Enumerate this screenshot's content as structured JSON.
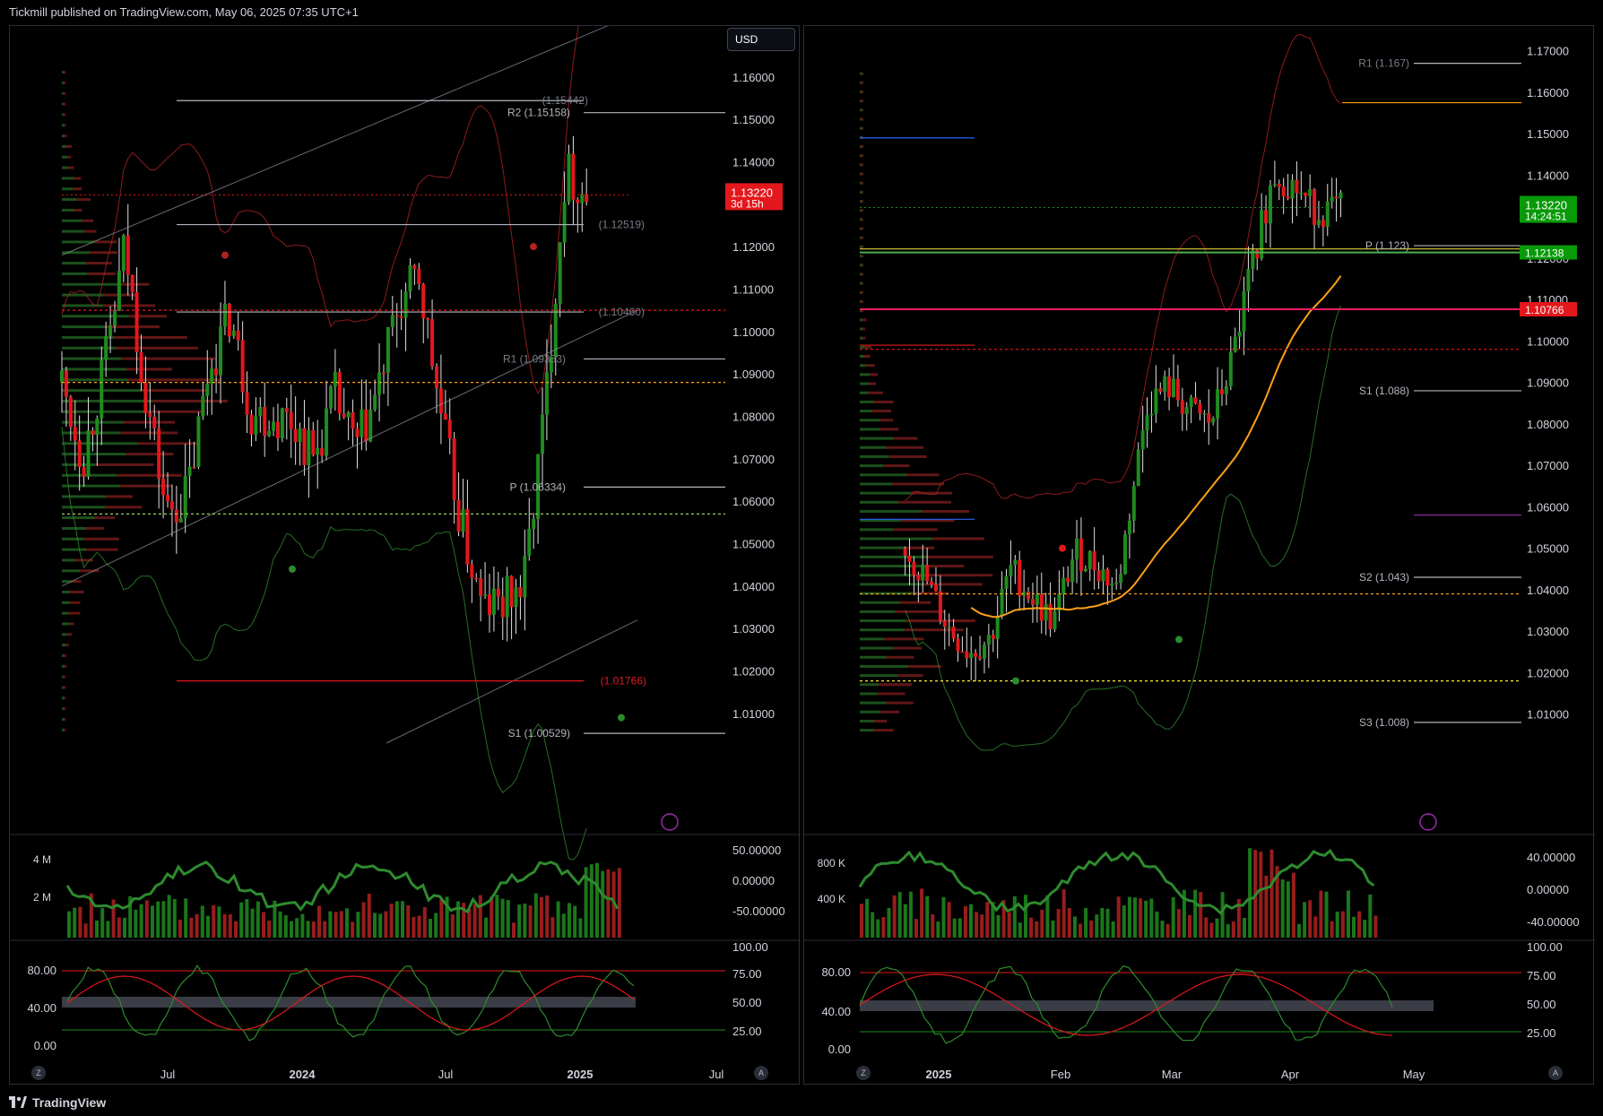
{
  "header": {
    "publisher_text": "Tickmill published on TradingView.com, May 06, 2025 07:35 UTC+1"
  },
  "footer": {
    "brand": "TradingView"
  },
  "colors": {
    "up": "#1e8c1e",
    "down": "#e3171c",
    "bg": "#000000",
    "grid": "#1c1f26"
  },
  "left_chart": {
    "currency": "USD",
    "price_ticks": [
      "1.16000",
      "1.15000",
      "1.14000",
      "1.13000",
      "1.12000",
      "1.11000",
      "1.10000",
      "1.09000",
      "1.08000",
      "1.07000",
      "1.06000",
      "1.05000",
      "1.04000",
      "1.03000",
      "1.02000",
      "1.01000"
    ],
    "time_ticks": [
      "Jul",
      "2024",
      "Jul",
      "2025",
      "Jul"
    ],
    "last_price": "1.13220",
    "countdown": "3d 15h",
    "levels": [
      "R2 (1.15158)",
      "(1.15442)",
      "(1.12519)",
      "(1.10460)",
      "R1 (1.09353)",
      "P (1.06334)",
      "(1.01766)",
      "S1 (1.00529)"
    ],
    "vol_ticks": [
      "4 M",
      "2 M"
    ],
    "osc_ticks": [
      "50.00000",
      "0.00000",
      "-50.00000"
    ],
    "stoch_left_ticks": [
      "80.00",
      "40.00",
      "0.00"
    ],
    "stoch_right_ticks": [
      "100.00",
      "75.00",
      "50.00",
      "25.00"
    ],
    "corner_left": "Z",
    "corner_right": "A"
  },
  "right_chart": {
    "price_ticks": [
      "1.17000",
      "1.16000",
      "1.15000",
      "1.14000",
      "1.13000",
      "1.12000",
      "1.11000",
      "1.10000",
      "1.09000",
      "1.08000",
      "1.07000",
      "1.06000",
      "1.05000",
      "1.04000",
      "1.03000",
      "1.02000",
      "1.01000"
    ],
    "time_ticks": [
      "2025",
      "Feb",
      "Mar",
      "Apr",
      "May"
    ],
    "last_price": "1.13220",
    "countdown": "14:24:51",
    "green_tag": "1.12138",
    "red_tag": "1.10766",
    "levels": [
      "R1 (1.167)",
      "P (1.123)",
      "S1 (1.088)",
      "S2 (1.043)",
      "S3 (1.008)"
    ],
    "vol_ticks": [
      "800 K",
      "400 K"
    ],
    "osc_ticks": [
      "40.00000",
      "0.00000",
      "-40.00000"
    ],
    "stoch_left_ticks": [
      "80.00",
      "40.00",
      "0.00"
    ],
    "stoch_right_ticks": [
      "100.00",
      "75.00",
      "50.00",
      "25.00"
    ],
    "corner_left": "Z",
    "corner_right": "A"
  },
  "chart_data": [
    {
      "type": "candlestick",
      "title": "",
      "ylim": [
        1.003,
        1.172
      ],
      "x_range": [
        "2023-04",
        "2025-07"
      ],
      "close_path": [
        {
          "x": "2023-04",
          "y": 1.088
        },
        {
          "x": "2023-05",
          "y": 1.07
        },
        {
          "x": "2023-06",
          "y": 1.091
        },
        {
          "x": "2023-07",
          "y": 1.12
        },
        {
          "x": "2023-08",
          "y": 1.085
        },
        {
          "x": "2023-09",
          "y": 1.057
        },
        {
          "x": "2023-10",
          "y": 1.062
        },
        {
          "x": "2023-11",
          "y": 1.091
        },
        {
          "x": "2023-12",
          "y": 1.104
        },
        {
          "x": "2024-01",
          "y": 1.081
        },
        {
          "x": "2024-02",
          "y": 1.08
        },
        {
          "x": "2024-03",
          "y": 1.079
        },
        {
          "x": "2024-04",
          "y": 1.07
        },
        {
          "x": "2024-05",
          "y": 1.085
        },
        {
          "x": "2024-06",
          "y": 1.072
        },
        {
          "x": "2024-07",
          "y": 1.085
        },
        {
          "x": "2024-08",
          "y": 1.105
        },
        {
          "x": "2024-09",
          "y": 1.113
        },
        {
          "x": "2024-10",
          "y": 1.082
        },
        {
          "x": "2024-11",
          "y": 1.055
        },
        {
          "x": "2024-12",
          "y": 1.035
        },
        {
          "x": "2025-01",
          "y": 1.036
        },
        {
          "x": "2025-02",
          "y": 1.04
        },
        {
          "x": "2025-03",
          "y": 1.081
        },
        {
          "x": "2025-04",
          "y": 1.138
        },
        {
          "x": "2025-05",
          "y": 1.132
        }
      ]
    },
    {
      "type": "candlestick",
      "title": "",
      "ylim": [
        1.003,
        1.176
      ],
      "x_range": [
        "2024-12",
        "2025-05"
      ],
      "close_path": [
        {
          "x": "2024-12-16",
          "y": 1.05
        },
        {
          "x": "2024-12-23",
          "y": 1.042
        },
        {
          "x": "2024-12-30",
          "y": 1.031
        },
        {
          "x": "2025-01-06",
          "y": 1.025
        },
        {
          "x": "2025-01-13",
          "y": 1.028
        },
        {
          "x": "2025-01-20",
          "y": 1.045
        },
        {
          "x": "2025-01-27",
          "y": 1.038
        },
        {
          "x": "2025-02-03",
          "y": 1.032
        },
        {
          "x": "2025-02-10",
          "y": 1.049
        },
        {
          "x": "2025-02-17",
          "y": 1.046
        },
        {
          "x": "2025-02-24",
          "y": 1.04
        },
        {
          "x": "2025-03-03",
          "y": 1.085
        },
        {
          "x": "2025-03-10",
          "y": 1.089
        },
        {
          "x": "2025-03-17",
          "y": 1.083
        },
        {
          "x": "2025-03-24",
          "y": 1.08
        },
        {
          "x": "2025-03-31",
          "y": 1.095
        },
        {
          "x": "2025-04-07",
          "y": 1.12
        },
        {
          "x": "2025-04-14",
          "y": 1.14
        },
        {
          "x": "2025-04-21",
          "y": 1.137
        },
        {
          "x": "2025-04-28",
          "y": 1.131
        },
        {
          "x": "2025-05-05",
          "y": 1.132
        }
      ]
    }
  ]
}
